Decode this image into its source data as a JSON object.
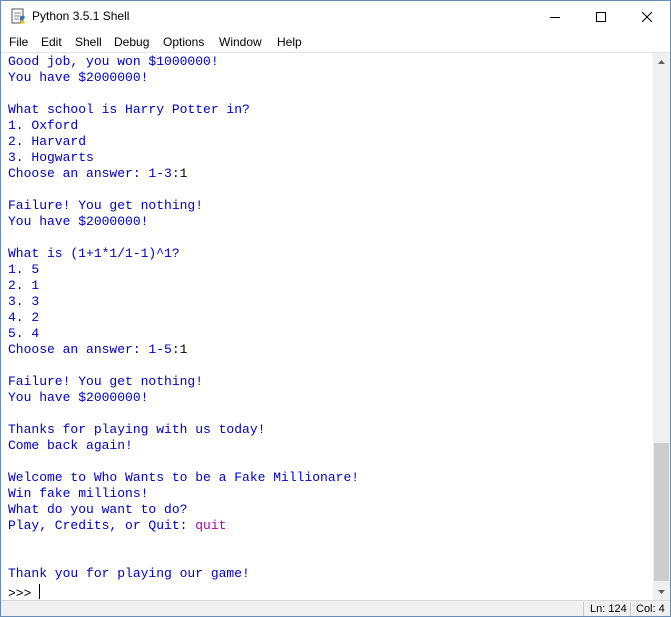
{
  "window": {
    "title": "Python 3.5.1 Shell",
    "app_icon": "python-idle-icon",
    "controls": [
      "minimize-icon",
      "maximize-icon",
      "close-icon"
    ]
  },
  "menu": {
    "items": [
      "File",
      "Edit",
      "Shell",
      "Debug",
      "Options",
      "Window",
      "Help"
    ]
  },
  "console": {
    "lines": [
      {
        "text": "Good job, you won $1000000!",
        "kind": "out"
      },
      {
        "text": "You have $2000000!",
        "kind": "out"
      },
      {
        "text": "",
        "kind": "out"
      },
      {
        "text": "What school is Harry Potter in?",
        "kind": "out"
      },
      {
        "text": "1. Oxford",
        "kind": "out"
      },
      {
        "text": "2. Harvard",
        "kind": "out"
      },
      {
        "text": "3. Hogwarts",
        "kind": "out"
      },
      {
        "text": "Choose an answer: 1-3:",
        "kind": "out",
        "input": "1"
      },
      {
        "text": "",
        "kind": "out"
      },
      {
        "text": "Failure! You get nothing!",
        "kind": "out"
      },
      {
        "text": "You have $2000000!",
        "kind": "out"
      },
      {
        "text": "",
        "kind": "out"
      },
      {
        "text": "What is (1+1*1/1-1)^1?",
        "kind": "out"
      },
      {
        "text": "1. 5",
        "kind": "out"
      },
      {
        "text": "2. 1",
        "kind": "out"
      },
      {
        "text": "3. 3",
        "kind": "out"
      },
      {
        "text": "4. 2",
        "kind": "out"
      },
      {
        "text": "5. 4",
        "kind": "out"
      },
      {
        "text": "Choose an answer: 1-5:",
        "kind": "out",
        "input": "1"
      },
      {
        "text": "",
        "kind": "out"
      },
      {
        "text": "Failure! You get nothing!",
        "kind": "out"
      },
      {
        "text": "You have $2000000!",
        "kind": "out"
      },
      {
        "text": "",
        "kind": "out"
      },
      {
        "text": "Thanks for playing with us today!",
        "kind": "out"
      },
      {
        "text": "Come back again!",
        "kind": "out"
      },
      {
        "text": "",
        "kind": "out"
      },
      {
        "text": "Welcome to Who Wants to be a Fake Millionare!",
        "kind": "out"
      },
      {
        "text": "Win fake millions!",
        "kind": "out"
      },
      {
        "text": "What do you want to do?",
        "kind": "out"
      },
      {
        "text": "Play, Credits, or Quit: ",
        "kind": "out",
        "input": "quit",
        "input_kind": "kw"
      },
      {
        "text": "",
        "kind": "out"
      },
      {
        "text": "",
        "kind": "out"
      },
      {
        "text": "Thank you for playing our game!",
        "kind": "out"
      }
    ],
    "prompt": ">>> "
  },
  "status": {
    "line": "Ln: 124",
    "col": "Col: 4"
  },
  "colors": {
    "output": "#0000c0",
    "input": "#000000",
    "keyword": "#b000b0"
  }
}
